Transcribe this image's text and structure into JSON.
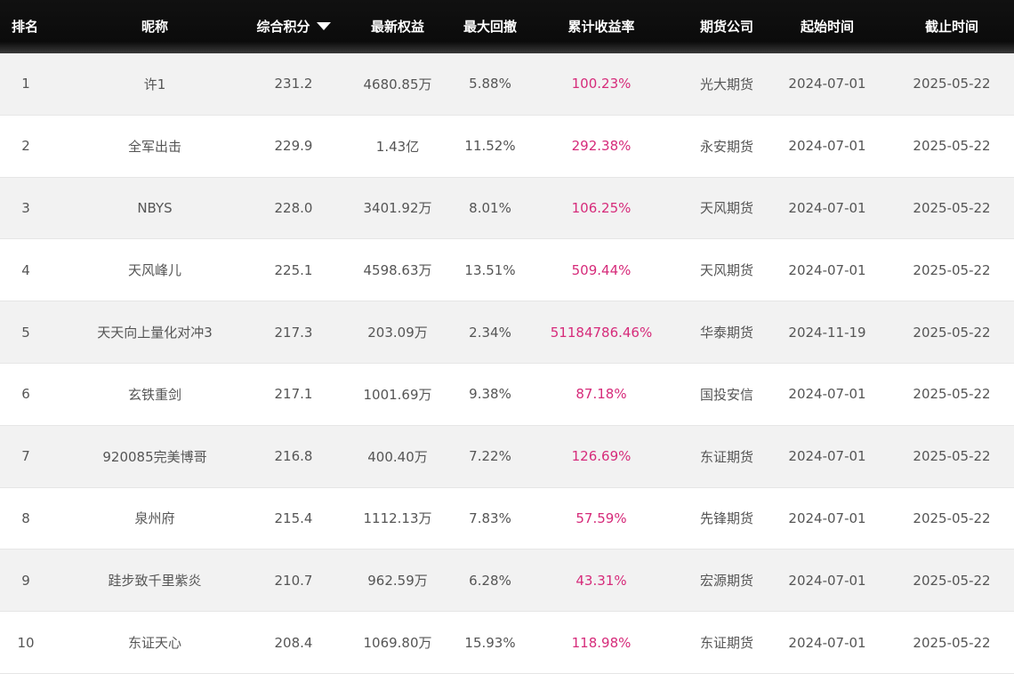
{
  "header": {
    "rank": "排名",
    "nickname": "昵称",
    "score": "综合积分",
    "sort_icon": "triangle-down-icon",
    "equity": "最新权益",
    "drawdown": "最大回撤",
    "return": "累计收益率",
    "company": "期货公司",
    "start": "起始时间",
    "end": "截止时间"
  },
  "colors": {
    "header_bg": "#111111",
    "header_text": "#ffffff",
    "row_alt_bg": "#f2f2f2",
    "text": "#555555",
    "return_text": "#d62b7a"
  },
  "rows": [
    {
      "rank": "1",
      "nickname": "许1",
      "score": "231.2",
      "equity": "4680.85万",
      "drawdown": "5.88%",
      "return": "100.23%",
      "company": "光大期货",
      "start": "2024-07-01",
      "end": "2025-05-22"
    },
    {
      "rank": "2",
      "nickname": "全军出击",
      "score": "229.9",
      "equity": "1.43亿",
      "drawdown": "11.52%",
      "return": "292.38%",
      "company": "永安期货",
      "start": "2024-07-01",
      "end": "2025-05-22"
    },
    {
      "rank": "3",
      "nickname": "NBYS",
      "score": "228.0",
      "equity": "3401.92万",
      "drawdown": "8.01%",
      "return": "106.25%",
      "company": "天风期货",
      "start": "2024-07-01",
      "end": "2025-05-22"
    },
    {
      "rank": "4",
      "nickname": "天风峰儿",
      "score": "225.1",
      "equity": "4598.63万",
      "drawdown": "13.51%",
      "return": "509.44%",
      "company": "天风期货",
      "start": "2024-07-01",
      "end": "2025-05-22"
    },
    {
      "rank": "5",
      "nickname": "天天向上量化对冲3",
      "score": "217.3",
      "equity": "203.09万",
      "drawdown": "2.34%",
      "return": "51184786.46%",
      "company": "华泰期货",
      "start": "2024-11-19",
      "end": "2025-05-22"
    },
    {
      "rank": "6",
      "nickname": "玄铁重剑",
      "score": "217.1",
      "equity": "1001.69万",
      "drawdown": "9.38%",
      "return": "87.18%",
      "company": "国投安信",
      "start": "2024-07-01",
      "end": "2025-05-22"
    },
    {
      "rank": "7",
      "nickname": "920085完美博哥",
      "score": "216.8",
      "equity": "400.40万",
      "drawdown": "7.22%",
      "return": "126.69%",
      "company": "东证期货",
      "start": "2024-07-01",
      "end": "2025-05-22"
    },
    {
      "rank": "8",
      "nickname": "泉州府",
      "score": "215.4",
      "equity": "1112.13万",
      "drawdown": "7.83%",
      "return": "57.59%",
      "company": "先锋期货",
      "start": "2024-07-01",
      "end": "2025-05-22"
    },
    {
      "rank": "9",
      "nickname": "跬步致千里紫炎",
      "score": "210.7",
      "equity": "962.59万",
      "drawdown": "6.28%",
      "return": "43.31%",
      "company": "宏源期货",
      "start": "2024-07-01",
      "end": "2025-05-22"
    },
    {
      "rank": "10",
      "nickname": "东证天心",
      "score": "208.4",
      "equity": "1069.80万",
      "drawdown": "15.93%",
      "return": "118.98%",
      "company": "东证期货",
      "start": "2024-07-01",
      "end": "2025-05-22"
    }
  ]
}
